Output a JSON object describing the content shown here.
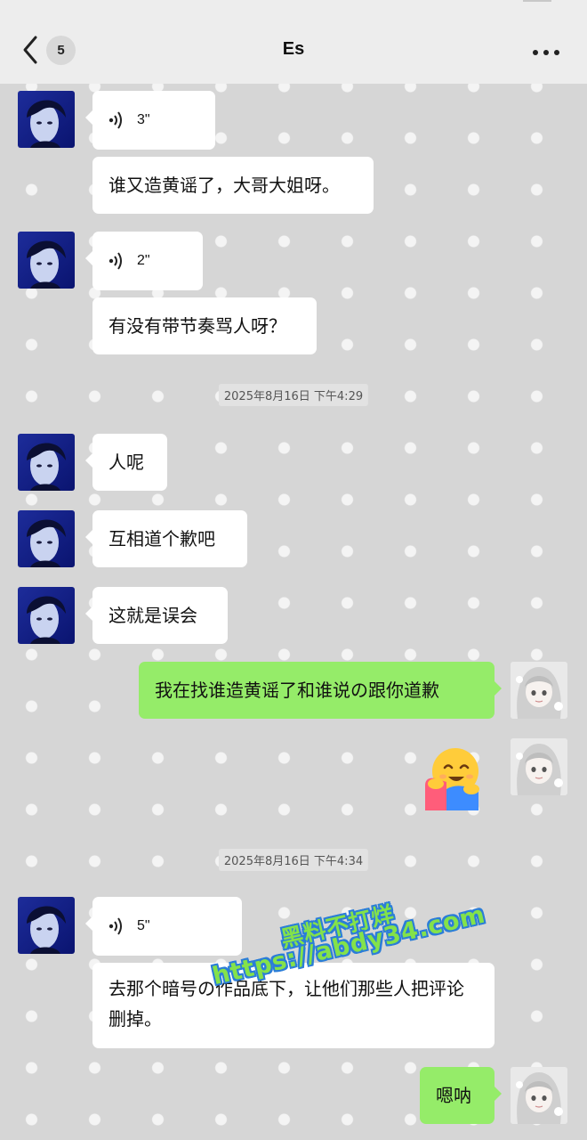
{
  "header": {
    "title": "Es",
    "unread_count": "5"
  },
  "colors": {
    "outgoing_bubble": "#95ec69",
    "incoming_bubble": "#ffffff",
    "watermark_fill": "#84e24a",
    "watermark_outline": "#2b7dd8"
  },
  "messages": [
    {
      "sender": "other",
      "type": "voice",
      "duration": "3\""
    },
    {
      "sender": "other",
      "type": "text",
      "text": "谁又造黄谣了，大哥大姐呀。"
    },
    {
      "sender": "other",
      "type": "voice",
      "duration": "2\""
    },
    {
      "sender": "other",
      "type": "text",
      "text": "有没有带节奏骂人呀？"
    },
    {
      "type": "timestamp",
      "text": "2025年8月16日 下午4:29"
    },
    {
      "sender": "other",
      "type": "text",
      "text": "人呢"
    },
    {
      "sender": "other",
      "type": "text",
      "text": "互相道个歉吧"
    },
    {
      "sender": "other",
      "type": "text",
      "text": "这就是误会"
    },
    {
      "sender": "me",
      "type": "text",
      "text": "我在找谁造黄谣了和谁说の跟你道歉"
    },
    {
      "sender": "me",
      "type": "sticker",
      "icon": "hugging-face-emoji"
    },
    {
      "type": "timestamp",
      "text": "2025年8月16日 下午4:34"
    },
    {
      "sender": "other",
      "type": "voice",
      "duration": "5\""
    },
    {
      "sender": "other",
      "type": "text",
      "text": "去那个暗号の作品底下，让他们那些人把评论删掉。"
    },
    {
      "sender": "me",
      "type": "text",
      "text": "嗯呐"
    }
  ],
  "watermark": {
    "line1": "黑料不打烊",
    "line2": "https://abdy34.com"
  }
}
